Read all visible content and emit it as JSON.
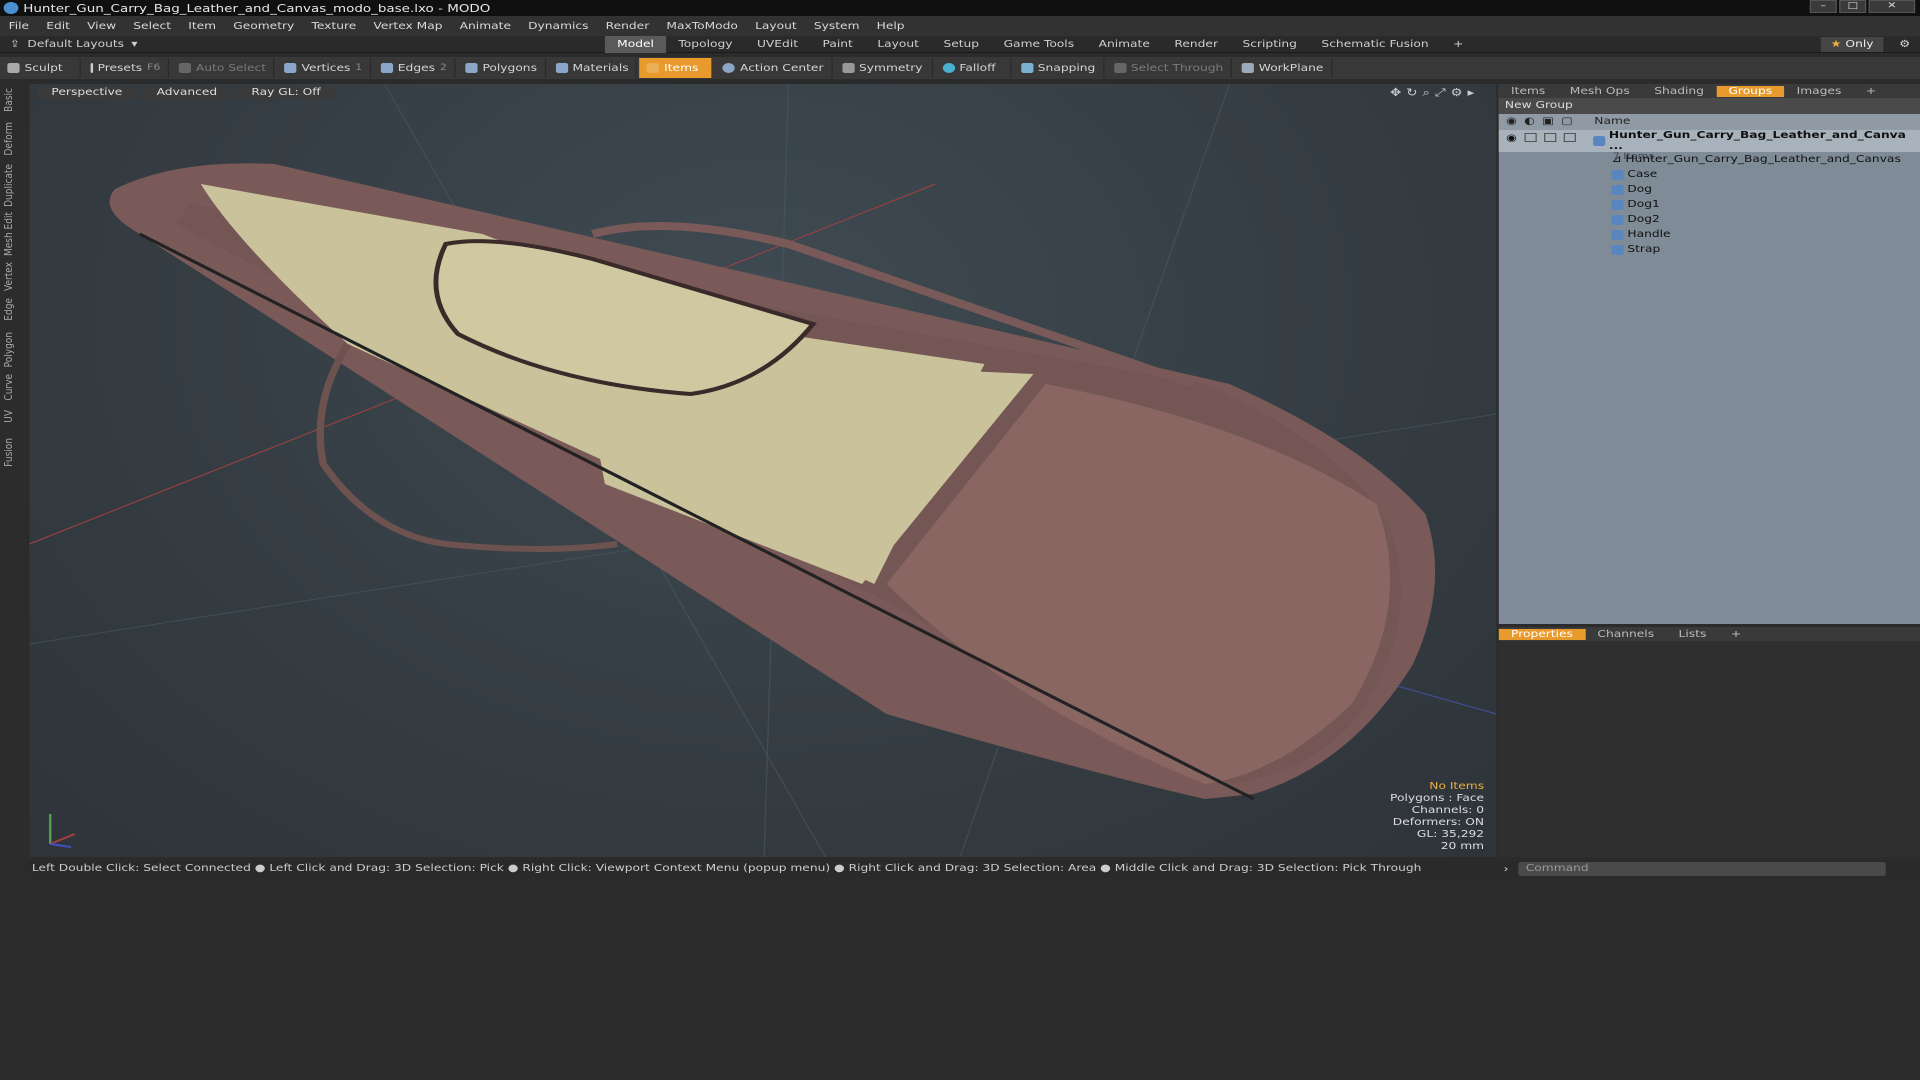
{
  "window": {
    "title": "Hunter_Gun_Carry_Bag_Leather_and_Canvas_modo_base.lxo - MODO"
  },
  "menu": [
    "File",
    "Edit",
    "View",
    "Select",
    "Item",
    "Geometry",
    "Texture",
    "Vertex Map",
    "Animate",
    "Dynamics",
    "Render",
    "MaxToModo",
    "Layout",
    "System",
    "Help"
  ],
  "modebar": {
    "layouts_label": "Default Layouts",
    "tabs": [
      "Model",
      "Topology",
      "UVEdit",
      "Paint",
      "Layout",
      "Setup",
      "Game Tools",
      "Animate",
      "Render",
      "Scripting",
      "Schematic Fusion"
    ],
    "add": "+",
    "only_label": "Only"
  },
  "toolbar": {
    "sculpt": "Sculpt",
    "presets": "Presets",
    "presets_key": "F6",
    "auto_select": "Auto Select",
    "vertices": "Vertices",
    "vertices_count": "1",
    "edges": "Edges",
    "edges_count": "2",
    "polygons": "Polygons",
    "materials": "Materials",
    "items": "Items",
    "action_center": "Action Center",
    "symmetry": "Symmetry",
    "falloff": "Falloff",
    "snapping": "Snapping",
    "select_through": "Select Through",
    "workplane": "WorkPlane"
  },
  "side_tabs": [
    "Basic",
    "Deform",
    "Duplicate",
    "Mesh Edit",
    "Vertex",
    "Edge",
    "Polygon",
    "Curve",
    "UV",
    "Fusion"
  ],
  "viewport": {
    "perspective": "Perspective",
    "advanced": "Advanced",
    "raygl": "Ray GL: Off",
    "info": {
      "no_items": "No Items",
      "polygons": "Polygons : Face",
      "channels": "Channels: 0",
      "deformers": "Deformers: ON",
      "gl": "GL: 35,292",
      "scale": "20 mm"
    }
  },
  "status": "Left Double Click: Select Connected ● Left Click and Drag: 3D Selection: Pick ● Right Click: Viewport Context Menu (popup menu) ● Right Click and Drag: 3D Selection: Area ● Middle Click and Drag: 3D Selection: Pick Through",
  "right_panel": {
    "tabs": [
      "Items",
      "Mesh Ops",
      "Shading",
      "Groups",
      "Images"
    ],
    "active_tab": "Groups",
    "new_group": "New Group",
    "name_col": "Name",
    "root": {
      "name": "Hunter_Gun_Carry_Bag_Leather_and_Canva ...",
      "count": "7 Items"
    },
    "children": [
      "Hunter_Gun_Carry_Bag_Leather_and_Canvas",
      "Case",
      "Dog",
      "Dog1",
      "Dog2",
      "Handle",
      "Strap"
    ]
  },
  "properties_panel": {
    "tabs": [
      "Properties",
      "Channels",
      "Lists"
    ]
  },
  "command": {
    "placeholder": "Command"
  },
  "colors": {
    "accent": "#e89a2c",
    "leather": "#7a5a58",
    "canvas": "#c9c29a"
  }
}
